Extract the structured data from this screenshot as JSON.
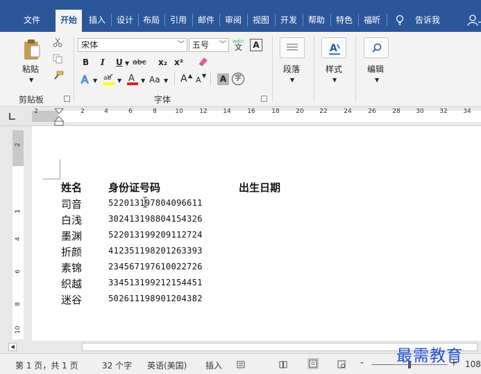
{
  "tabs": [
    "文件",
    "开始",
    "插入",
    "设计",
    "布局",
    "引用",
    "邮件",
    "审阅",
    "视图",
    "开发",
    "帮助",
    "特色",
    "福昕"
  ],
  "tell_me": "告诉我",
  "ribbon": {
    "clipboard": {
      "paste_label": "粘贴",
      "group_label": "剪贴板"
    },
    "font": {
      "font_name": "宋体",
      "font_size": "五号",
      "bold": "B",
      "italic": "I",
      "underline": "U",
      "strike": "abc",
      "subscript": "x₂",
      "superscript": "x²",
      "change_case": "Aa",
      "grow": "A",
      "shrink": "A",
      "char_shade": "A",
      "enclose": "字",
      "phonetic": "wén",
      "phonetic_char": "文",
      "border_char": "A",
      "group_label": "字体"
    },
    "paragraph_label": "段落",
    "styles_label": "样式",
    "editing_label": "编辑"
  },
  "ruler": {
    "marks": [
      "2",
      "2",
      "4",
      "6",
      "8",
      "10",
      "12",
      "14",
      "16",
      "18",
      "20",
      "22",
      "24",
      "26",
      "28",
      "30",
      "32",
      "34"
    ],
    "vmarks": [
      "2",
      "1",
      "2",
      "4",
      "6",
      "8",
      "10"
    ]
  },
  "table": {
    "headers": [
      "姓名",
      "身份证号码",
      "出生日期"
    ],
    "rows": [
      {
        "name": "司音",
        "id": "522013197804096611"
      },
      {
        "name": "白浅",
        "id": "302413198804154326"
      },
      {
        "name": "墨渊",
        "id": "522013199209112724"
      },
      {
        "name": "折颜",
        "id": "412351198201263393"
      },
      {
        "name": "素锦",
        "id": "234567197610022726"
      },
      {
        "name": "织越",
        "id": "334513199212154451"
      },
      {
        "name": "迷谷",
        "id": "502611198901204382"
      }
    ]
  },
  "status": {
    "page": "第 1 页，共 1 页",
    "words": "32 个字",
    "language": "英语(美国)",
    "insert_mode": "插入",
    "zoom": "108"
  },
  "watermark": "最需教育",
  "colors": {
    "ribbon_blue": "#2b579a",
    "watermark": "#1e4fd8"
  }
}
